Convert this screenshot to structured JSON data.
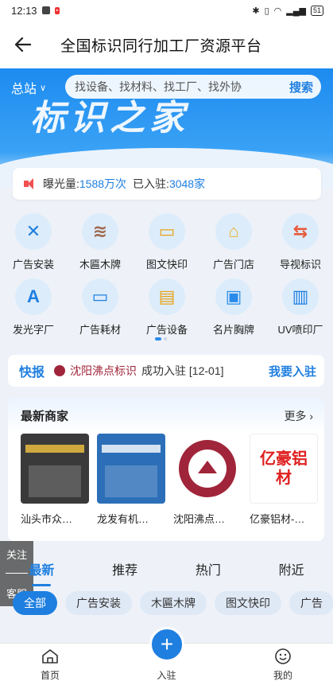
{
  "status_bar": {
    "time": "12:13",
    "battery": "51"
  },
  "header": {
    "title": "全国标识同行加工厂资源平台"
  },
  "hero": {
    "station": "总站",
    "brand": "标识之家",
    "search_placeholder": "找设备、找材料、找工厂、找外协",
    "search_button": "搜索"
  },
  "stats": {
    "exposure_label": "曝光量:",
    "exposure_value": "1588万次",
    "joined_label": "已入驻:",
    "joined_value": "3048家"
  },
  "categories": [
    {
      "label": "广告安装",
      "icon": "tools-icon",
      "glyph": "✕",
      "color": "#1f7fe0"
    },
    {
      "label": "木匾木牌",
      "icon": "wood-icon",
      "glyph": "≋",
      "color": "#a0674a"
    },
    {
      "label": "图文快印",
      "icon": "wallet-icon",
      "glyph": "▭",
      "color": "#e8a317"
    },
    {
      "label": "广告门店",
      "icon": "store-icon",
      "glyph": "⌂",
      "color": "#f0b429"
    },
    {
      "label": "导视标识",
      "icon": "signpost-icon",
      "glyph": "⇆",
      "color": "#e85a3a"
    },
    {
      "label": "发光字厂",
      "icon": "letter-a-icon",
      "glyph": "A",
      "color": "#1f7fe0"
    },
    {
      "label": "广告耗材",
      "icon": "wallet-icon",
      "glyph": "▭",
      "color": "#1f7fe0"
    },
    {
      "label": "广告设备",
      "icon": "ticket-icon",
      "glyph": "▤",
      "color": "#e8a317"
    },
    {
      "label": "名片胸牌",
      "icon": "badge-icon",
      "glyph": "▣",
      "color": "#2a8bea"
    },
    {
      "label": "UV喷印厂",
      "icon": "printer-icon",
      "glyph": "▥",
      "color": "#1f7fe0"
    }
  ],
  "news": {
    "tag": "快报",
    "company": "沈阳沸点标识",
    "message": "成功入驻 [12-01]",
    "join_label": "我要入驻"
  },
  "merchants": {
    "title": "最新商家",
    "more_label": "更多 ›",
    "items": [
      {
        "name": "汕头市众…",
        "bg": "#3a3a3a",
        "text": "",
        "text_color": "#f5c542"
      },
      {
        "name": "龙发有机…",
        "bg": "#2c6fb8",
        "text": "",
        "text_color": "#ffffff"
      },
      {
        "name": "沈阳沸点…",
        "bg": "#ffffff",
        "text": "",
        "text_color": "#a0253a"
      },
      {
        "name": "亿豪铝材-…",
        "bg": "#ffffff",
        "text": "亿豪铝材",
        "text_color": "#e02020"
      }
    ]
  },
  "tabs": [
    "最新",
    "推荐",
    "热门",
    "附近"
  ],
  "chips": [
    "全部",
    "广告安装",
    "木匾木牌",
    "图文快印",
    "广告"
  ],
  "floating": {
    "follow": "关注",
    "service": "客服"
  },
  "bottom_nav": {
    "home": "首页",
    "join": "入驻",
    "mine": "我的",
    "plus": "+"
  }
}
